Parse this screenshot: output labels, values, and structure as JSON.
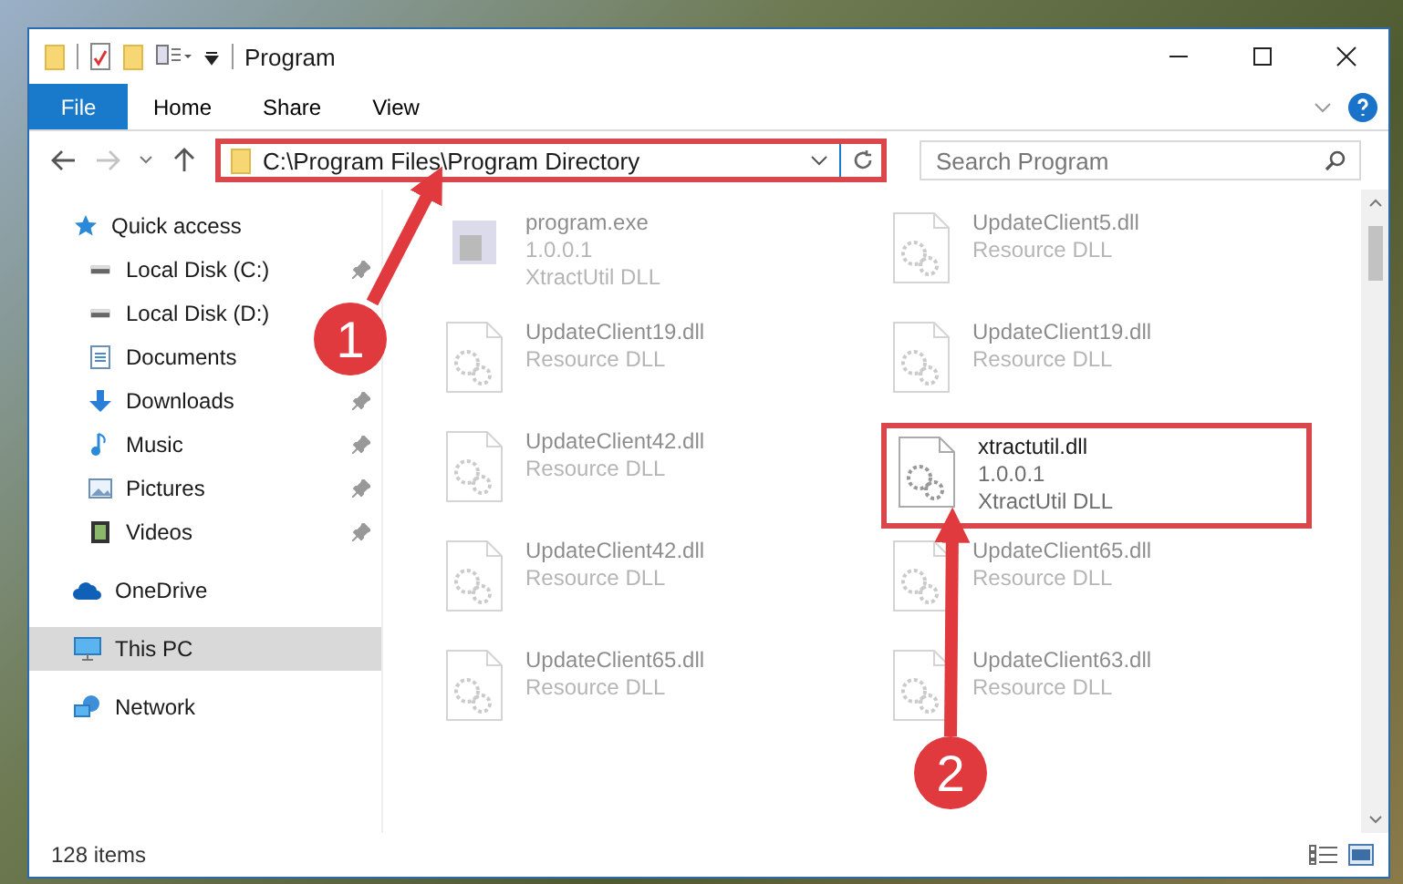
{
  "window": {
    "title": "Program"
  },
  "ribbon_tabs": [
    {
      "label": "File",
      "selected": true
    },
    {
      "label": "Home",
      "selected": false
    },
    {
      "label": "Share",
      "selected": false
    },
    {
      "label": "View",
      "selected": false
    }
  ],
  "address": {
    "path": "C:\\Program Files\\Program Directory",
    "highlighted": true
  },
  "search": {
    "placeholder": "Search Program"
  },
  "sidebar": {
    "items": [
      {
        "label": "Quick access",
        "selected": false,
        "children": [
          {
            "label": "Local Disk (C:)",
            "pinned": true
          },
          {
            "label": "Local Disk (D:)",
            "pinned": false
          },
          {
            "label": "Documents",
            "pinned": false
          },
          {
            "label": "Downloads",
            "pinned": true
          },
          {
            "label": "Music",
            "pinned": true
          },
          {
            "label": "Pictures",
            "pinned": true
          },
          {
            "label": "Videos",
            "pinned": true
          }
        ]
      },
      {
        "label": "OneDrive",
        "selected": false
      },
      {
        "label": "This PC",
        "selected": true
      },
      {
        "label": "Network",
        "selected": false
      }
    ]
  },
  "files": [
    {
      "name": "program.exe",
      "kind": "exe",
      "highlighted": false,
      "details": [
        "1.0.0.1",
        "XtractUtil DLL"
      ]
    },
    {
      "name": "UpdateClient5.dll",
      "kind": "dll",
      "highlighted": false,
      "details": [
        "Resource DLL"
      ]
    },
    {
      "name": "UpdateClient19.dll",
      "kind": "dll",
      "highlighted": false,
      "details": [
        "Resource DLL"
      ]
    },
    {
      "name": "UpdateClient19.dll",
      "kind": "dll",
      "highlighted": false,
      "details": [
        "Resource DLL"
      ]
    },
    {
      "name": "UpdateClient42.dll",
      "kind": "dll",
      "highlighted": false,
      "details": [
        "Resource DLL"
      ]
    },
    {
      "name": "xtractutil.dll",
      "kind": "dll",
      "highlighted": true,
      "details": [
        "1.0.0.1",
        "XtractUtil DLL"
      ]
    },
    {
      "name": "UpdateClient42.dll",
      "kind": "dll",
      "highlighted": false,
      "details": [
        "Resource DLL"
      ]
    },
    {
      "name": "UpdateClient65.dll",
      "kind": "dll",
      "highlighted": false,
      "details": [
        "Resource DLL"
      ]
    },
    {
      "name": "UpdateClient65.dll",
      "kind": "dll",
      "highlighted": false,
      "details": [
        "Resource DLL"
      ]
    },
    {
      "name": "UpdateClient63.dll",
      "kind": "dll",
      "highlighted": false,
      "details": [
        "Resource DLL"
      ]
    }
  ],
  "callouts": [
    {
      "label": "1"
    },
    {
      "label": "2"
    }
  ],
  "status_bar": {
    "item_count": "128 items"
  }
}
